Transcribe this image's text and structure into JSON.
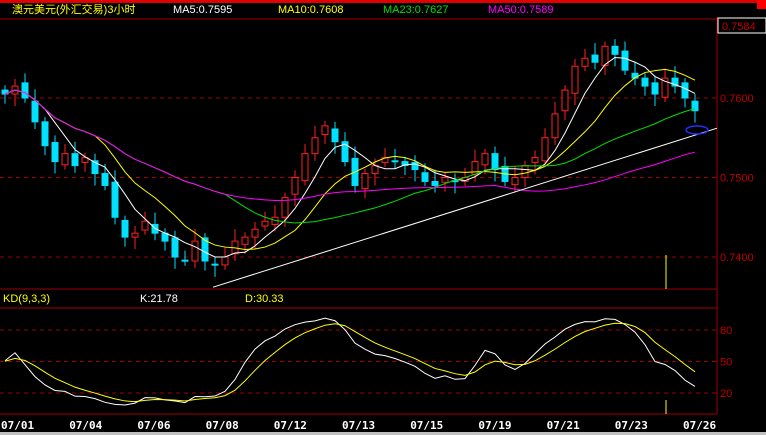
{
  "header": {
    "title": "澳元美元(外汇交易)3小时",
    "ma5": "MA5:0.7595",
    "ma10": "MA10:0.7608",
    "ma23": "MA23:0.7627",
    "ma50": "MA50:0.7589"
  },
  "current_price": "0.7584",
  "kd_header": {
    "label": "KD(9,3,3)",
    "k": "K:21.78",
    "d": "D:30.33"
  },
  "colors": {
    "up": "#ff2020",
    "down": "#00e0ff",
    "ma5": "#ffffff",
    "ma10": "#ffff00",
    "ma23": "#00e000",
    "ma50": "#ff00ff",
    "grid": "#a00000",
    "trend": "#ffffff"
  },
  "chart_data": [
    {
      "type": "candlestick",
      "title": "澳元美元(外汇交易)3小时",
      "ylim": [
        0.7345,
        0.7685
      ],
      "yticks": [
        "0.7600",
        "0.7500",
        "0.7400"
      ],
      "ytick_values": [
        0.76,
        0.75,
        0.74
      ],
      "xticks": [
        "07/01",
        "07/04",
        "07/06",
        "07/08",
        "07/12",
        "07/13",
        "07/15",
        "07/19",
        "07/21",
        "07/23",
        "07/26"
      ],
      "closes": [
        0.7605,
        0.7615,
        0.76,
        0.757,
        0.754,
        0.752,
        0.753,
        0.7515,
        0.7525,
        0.7505,
        0.749,
        0.745,
        0.7425,
        0.743,
        0.7445,
        0.743,
        0.742,
        0.74,
        0.7395,
        0.742,
        0.7395,
        0.739,
        0.74,
        0.742,
        0.7425,
        0.7435,
        0.7445,
        0.745,
        0.7475,
        0.75,
        0.753,
        0.755,
        0.7565,
        0.7545,
        0.752,
        0.749,
        0.7505,
        0.7515,
        0.7525,
        0.752,
        0.7515,
        0.751,
        0.7495,
        0.749,
        0.75,
        0.7495,
        0.75,
        0.752,
        0.753,
        0.751,
        0.7495,
        0.75,
        0.7515,
        0.7525,
        0.755,
        0.758,
        0.761,
        0.764,
        0.765,
        0.7645,
        0.7665,
        0.7655,
        0.7635,
        0.7625,
        0.7615,
        0.7605,
        0.7625,
        0.7615,
        0.76,
        0.7584
      ],
      "moving_averages": [
        5,
        10,
        23,
        50
      ],
      "trendline": {
        "from": [
          20.8,
          0.7362
        ],
        "to": [
          71.2,
          0.7562
        ]
      }
    },
    {
      "type": "line",
      "title": "KD(9,3,3)",
      "ylim": [
        0,
        100
      ],
      "yticks": [
        "80",
        "50",
        "20"
      ],
      "ytick_values": [
        80,
        50,
        20
      ],
      "series": [
        {
          "name": "K",
          "last": 21.78
        },
        {
          "name": "D",
          "last": 30.33
        }
      ]
    }
  ]
}
